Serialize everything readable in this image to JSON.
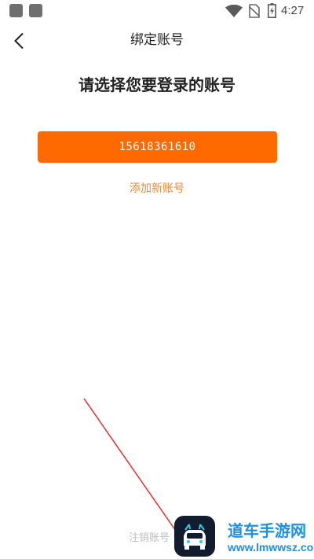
{
  "status_bar": {
    "time": "4:27",
    "icons": [
      "app-square-icon",
      "app-square-icon",
      "wifi-icon",
      "no-sim-icon",
      "battery-charging-icon"
    ]
  },
  "header": {
    "back_icon": "chevron-left-icon",
    "title": "绑定账号"
  },
  "main": {
    "heading": "请选择您要登录的账号",
    "account_button_label": "15618361610",
    "add_account_label": "添加新账号",
    "cancel_account_label": "注销账号"
  },
  "watermark": {
    "title": "道车手游网",
    "url": "www.lmwwsz.com"
  },
  "colors": {
    "accent": "#ff6a00",
    "link": "#e98a3a",
    "annotation_arrow": "#e53030",
    "watermark_text": "#1f8fe0"
  }
}
